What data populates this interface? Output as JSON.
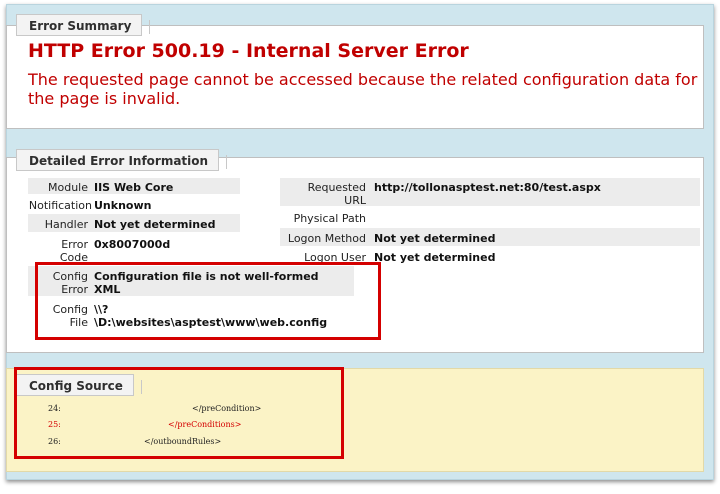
{
  "summary": {
    "tab": "Error Summary",
    "title": "HTTP Error 500.19 - Internal Server Error",
    "description": "The requested page cannot be accessed because the related configuration data for the page is invalid."
  },
  "details": {
    "tab": "Detailed Error Information",
    "left": [
      {
        "label": "Module",
        "value": "IIS Web Core"
      },
      {
        "label": "Notification",
        "value": "Unknown"
      },
      {
        "label": "Handler",
        "value": "Not yet determined"
      },
      {
        "label_lines": [
          "Error",
          "Code"
        ],
        "value": "0x8007000d"
      },
      {
        "label_lines": [
          "Config",
          "Error"
        ],
        "value_lines": [
          "Configuration file is not well-formed",
          "XML"
        ]
      },
      {
        "label_lines": [
          "Config",
          "File"
        ],
        "value_lines": [
          "\\\\?",
          "\\D:\\websites\\asptest\\www\\web.config"
        ]
      }
    ],
    "right": [
      {
        "label_lines": [
          "Requested",
          "URL"
        ],
        "value": "http://tollonasptest.net:80/test.aspx"
      },
      {
        "label": "Physical Path",
        "value": ""
      },
      {
        "label": "Logon Method",
        "value": "Not yet determined"
      },
      {
        "label": "Logon User",
        "value": "Not yet determined"
      }
    ]
  },
  "source": {
    "tab": "Config Source",
    "lines": [
      {
        "num": "24:",
        "code": "</preCondition>"
      },
      {
        "num": "25:",
        "code": "</preConditions>"
      },
      {
        "num": "26:",
        "code": "</outboundRules>"
      }
    ]
  },
  "colors": {
    "error": "#c00000",
    "highlight_box": "#d40000",
    "source_bg": "#fbf3c6"
  }
}
